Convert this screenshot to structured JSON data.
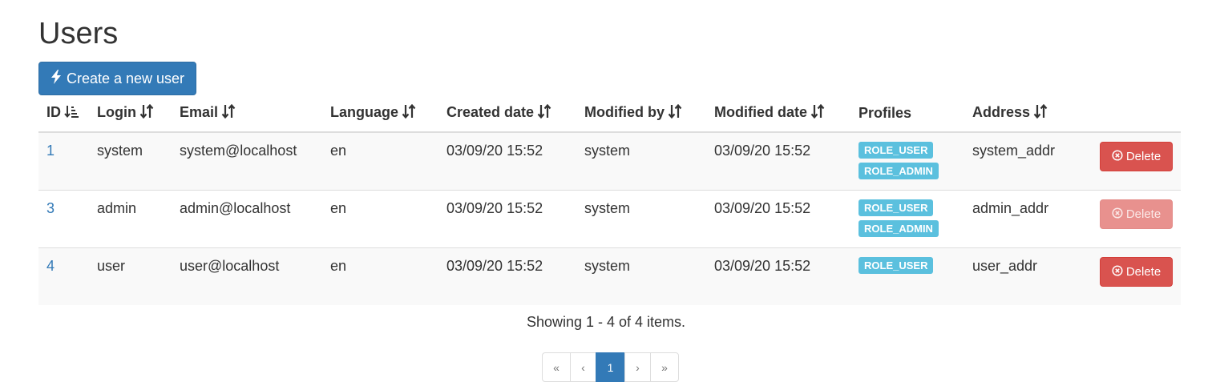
{
  "page": {
    "title": "Users"
  },
  "toolbar": {
    "create_label": "Create a new user",
    "create_icon": "bolt-icon"
  },
  "table": {
    "columns": [
      {
        "label": "ID",
        "sort_icon": "sort-amount-down-icon"
      },
      {
        "label": "Login",
        "sort_icon": "sort-icon"
      },
      {
        "label": "Email",
        "sort_icon": "sort-icon"
      },
      {
        "label": "Language",
        "sort_icon": "sort-icon"
      },
      {
        "label": "Created date",
        "sort_icon": "sort-icon"
      },
      {
        "label": "Modified by",
        "sort_icon": "sort-icon"
      },
      {
        "label": "Modified date",
        "sort_icon": "sort-icon"
      },
      {
        "label": "Profiles",
        "sort_icon": ""
      },
      {
        "label": "Address",
        "sort_icon": "sort-icon"
      },
      {
        "label": "",
        "sort_icon": ""
      }
    ],
    "rows": [
      {
        "id": "1",
        "login": "system",
        "email": "system@localhost",
        "language": "en",
        "created_date": "03/09/20 15:52",
        "modified_by": "system",
        "modified_date": "03/09/20 15:52",
        "profiles": [
          "ROLE_USER",
          "ROLE_ADMIN"
        ],
        "address": "system_addr",
        "delete_label": "Delete",
        "delete_enabled": true
      },
      {
        "id": "3",
        "login": "admin",
        "email": "admin@localhost",
        "language": "en",
        "created_date": "03/09/20 15:52",
        "modified_by": "system",
        "modified_date": "03/09/20 15:52",
        "profiles": [
          "ROLE_USER",
          "ROLE_ADMIN"
        ],
        "address": "admin_addr",
        "delete_label": "Delete",
        "delete_enabled": false
      },
      {
        "id": "4",
        "login": "user",
        "email": "user@localhost",
        "language": "en",
        "created_date": "03/09/20 15:52",
        "modified_by": "system",
        "modified_date": "03/09/20 15:52",
        "profiles": [
          "ROLE_USER"
        ],
        "address": "user_addr",
        "delete_label": "Delete",
        "delete_enabled": true
      }
    ]
  },
  "summary": "Showing 1 - 4 of 4 items.",
  "pagination": {
    "first": "«",
    "prev": "‹",
    "current": "1",
    "next": "›",
    "last": "»"
  },
  "colors": {
    "primary": "#337ab7",
    "danger": "#d9534f",
    "info": "#5bc0de"
  }
}
